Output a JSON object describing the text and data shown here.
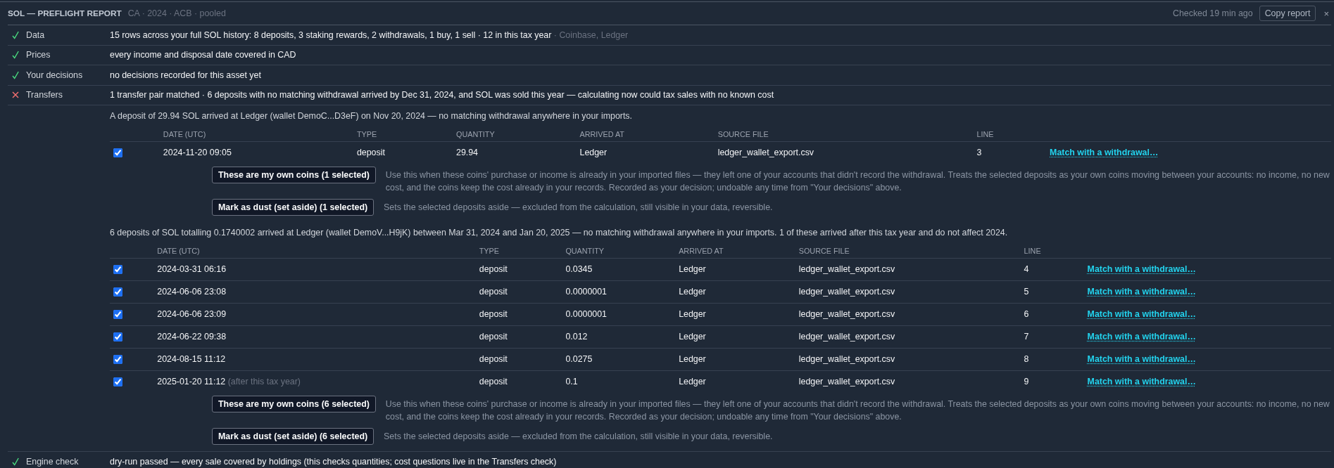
{
  "header": {
    "title": "SOL — PREFLIGHT REPORT",
    "context": "CA · 2024 · ACB · pooled",
    "checked": "Checked 19 min ago",
    "copy_button": "Copy report",
    "close_button": "×"
  },
  "checks": [
    {
      "passed": true,
      "label": "Data",
      "text": "15 rows across your full SOL history: 8 deposits, 3 staking rewards, 2 withdrawals, 1 buy, 1 sell · 12 in this tax year",
      "note": "· Coinbase, Ledger"
    },
    {
      "passed": true,
      "label": "Prices",
      "text": "every income and disposal date covered in CAD"
    },
    {
      "passed": true,
      "label": "Your decisions",
      "text": "no decisions recorded for this asset yet"
    },
    {
      "passed": false,
      "label": "Transfers",
      "text": "1 transfer pair matched · 6 deposits with no matching withdrawal arrived by Dec 31, 2024, and SOL was sold this year — calculating now could tax sales with no known cost",
      "groups": [
        {
          "summary": "A deposit of 29.94 SOL arrived at Ledger (wallet DemoC...D3eF) on Nov 20, 2024 — no matching withdrawal anywhere in your imports.",
          "columns": [
            "DATE (UTC)",
            "TYPE",
            "QUANTITY",
            "ARRIVED AT",
            "SOURCE FILE",
            "LINE"
          ],
          "rows": [
            {
              "checked": true,
              "date": "2024-11-20 09:05",
              "type": "deposit",
              "quantity": "29.94",
              "arrived_at": "Ledger",
              "source_file": "ledger_wallet_export.csv",
              "line": "3",
              "link": "Match with a withdrawal…"
            }
          ],
          "actions": [
            {
              "label": "These are my own coins (1 selected)",
              "description": "Use this when these coins' purchase or income is already in your imported files — they left one of your accounts that didn't record the withdrawal. Treats the selected deposits as your own coins moving between your accounts: no income, no new cost, and the coins keep the cost already in your records. Recorded as your decision; undoable any time from \"Your decisions\" above."
            },
            {
              "label": "Mark as dust (set aside) (1 selected)",
              "description": "Sets the selected deposits aside — excluded from the calculation, still visible in your data, reversible."
            }
          ]
        },
        {
          "summary": "6 deposits of SOL totalling 0.1740002 arrived at Ledger (wallet DemoV...H9jK) between Mar 31, 2024 and Jan 20, 2025 — no matching withdrawal anywhere in your imports. 1 of these arrived after this tax year and do not affect 2024.",
          "columns": [
            "DATE (UTC)",
            "TYPE",
            "QUANTITY",
            "ARRIVED AT",
            "SOURCE FILE",
            "LINE"
          ],
          "rows": [
            {
              "checked": true,
              "date": "2024-03-31 06:16",
              "type": "deposit",
              "quantity": "0.0345",
              "arrived_at": "Ledger",
              "source_file": "ledger_wallet_export.csv",
              "line": "4",
              "link": "Match with a withdrawal…"
            },
            {
              "checked": true,
              "date": "2024-06-06 23:08",
              "type": "deposit",
              "quantity": "0.0000001",
              "arrived_at": "Ledger",
              "source_file": "ledger_wallet_export.csv",
              "line": "5",
              "link": "Match with a withdrawal…"
            },
            {
              "checked": true,
              "date": "2024-06-06 23:09",
              "type": "deposit",
              "quantity": "0.0000001",
              "arrived_at": "Ledger",
              "source_file": "ledger_wallet_export.csv",
              "line": "6",
              "link": "Match with a withdrawal…"
            },
            {
              "checked": true,
              "date": "2024-06-22 09:38",
              "type": "deposit",
              "quantity": "0.012",
              "arrived_at": "Ledger",
              "source_file": "ledger_wallet_export.csv",
              "line": "7",
              "link": "Match with a withdrawal…"
            },
            {
              "checked": true,
              "date": "2024-08-15 11:12",
              "type": "deposit",
              "quantity": "0.0275",
              "arrived_at": "Ledger",
              "source_file": "ledger_wallet_export.csv",
              "line": "8",
              "link": "Match with a withdrawal…"
            },
            {
              "checked": true,
              "date": "2025-01-20 11:12",
              "date_note": "(after this tax year)",
              "type": "deposit",
              "quantity": "0.1",
              "arrived_at": "Ledger",
              "source_file": "ledger_wallet_export.csv",
              "line": "9",
              "link": "Match with a withdrawal…"
            }
          ],
          "actions": [
            {
              "label": "These are my own coins (6 selected)",
              "description": "Use this when these coins' purchase or income is already in your imported files — they left one of your accounts that didn't record the withdrawal. Treats the selected deposits as your own coins moving between your accounts: no income, no new cost, and the coins keep the cost already in your records. Recorded as your decision; undoable any time from \"Your decisions\" above."
            },
            {
              "label": "Mark as dust (set aside) (6 selected)",
              "description": "Sets the selected deposits aside — excluded from the calculation, still visible in your data, reversible."
            }
          ]
        }
      ]
    },
    {
      "passed": true,
      "label": "Engine check",
      "text": "dry-run passed — every sale covered by holdings (this checks quantities; cost questions live in the Transfers check)"
    }
  ]
}
